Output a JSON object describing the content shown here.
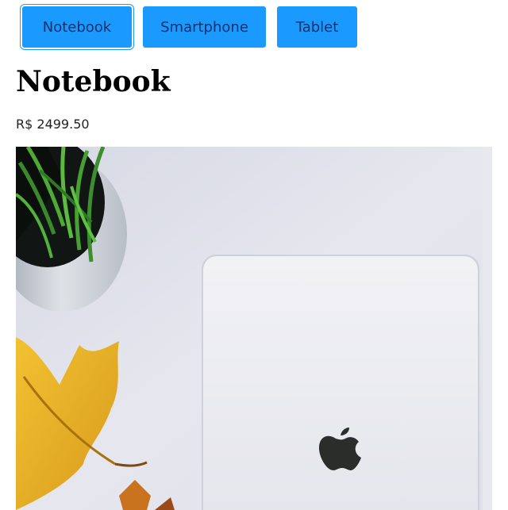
{
  "tabs": [
    {
      "label": "Notebook",
      "active": true
    },
    {
      "label": "Smartphone",
      "active": false
    },
    {
      "label": "Tablet",
      "active": false
    }
  ],
  "product": {
    "title": "Notebook",
    "price": "R$ 2499.50",
    "image_subject": "laptop-with-plant-and-leaf-photo"
  },
  "colors": {
    "tab_bg": "#1a99ff",
    "tab_text": "#12326b",
    "photo_bg": "#e3e4ec",
    "laptop": "#f4f4f6"
  }
}
